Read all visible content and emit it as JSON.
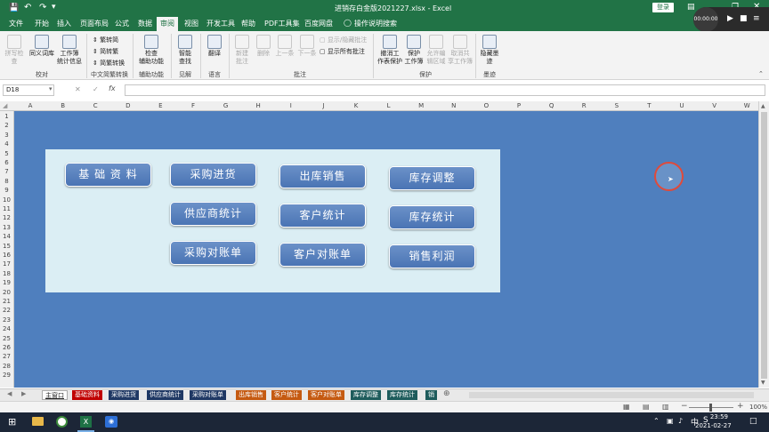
{
  "window": {
    "title": "进销存白金版2021227.xlsx  -  Excel",
    "login_label": "登录",
    "qat_icons": [
      "save-icon",
      "undo-icon",
      "redo-icon",
      "customize-icon"
    ]
  },
  "menu": {
    "items": [
      "文件",
      "开始",
      "插入",
      "页面布局",
      "公式",
      "数据",
      "审阅",
      "视图",
      "开发工具",
      "帮助",
      "PDF工具集",
      "百度网盘"
    ],
    "active": "审阅",
    "tell_me": "操作说明搜索"
  },
  "recorder": {
    "time": "00:00:00"
  },
  "ribbon": {
    "proofing": {
      "spell": "拼写检查",
      "thesaurus": "同义词库",
      "stats": "工作簿\n统计信息",
      "label": "校对"
    },
    "chinese": {
      "to_simplified": "繁转简",
      "to_traditional": "简转繁",
      "convert": "简繁转换",
      "label": "中文简繁转换"
    },
    "access": {
      "check": "检查\n辅助功能",
      "label": "辅助功能"
    },
    "insights": {
      "smart": "智能\n查找",
      "label": "见解"
    },
    "language": {
      "translate": "翻译",
      "label": "语言"
    },
    "comments": {
      "new": "新建\n批注",
      "delete": "删除",
      "prev": "上一条",
      "next": "下一条",
      "show_hide": "显示/隐藏批注",
      "show_all": "显示所有批注",
      "label": "批注"
    },
    "protect": {
      "unprotect": "撤消工\n作表保护",
      "protect_wb": "保护\n工作簿",
      "allow": "允许编\n辑区域",
      "unshare": "取消共\n享工作簿",
      "label": "保护"
    },
    "ink": {
      "hide": "隐藏墨\n迹",
      "label": "墨迹"
    }
  },
  "formula_bar": {
    "name_box": "D18",
    "formula": ""
  },
  "columns": [
    "A",
    "B",
    "C",
    "D",
    "E",
    "F",
    "G",
    "H",
    "I",
    "J",
    "K",
    "L",
    "M",
    "N",
    "O",
    "P",
    "Q",
    "R",
    "S",
    "T",
    "U",
    "V",
    "W"
  ],
  "rows": [
    "1",
    "2",
    "3",
    "4",
    "5",
    "6",
    "7",
    "8",
    "9",
    "10",
    "11",
    "12",
    "13",
    "14",
    "15",
    "16",
    "17",
    "18",
    "19",
    "20",
    "21",
    "22",
    "23",
    "24",
    "25",
    "26",
    "27",
    "28",
    "29"
  ],
  "nav_buttons": [
    "基 础 资 料",
    "采购进货",
    "出库销售",
    "库存调整",
    "供应商统计",
    "客户统计",
    "库存统计",
    "采购对账单",
    "客户对账单",
    "销售利润"
  ],
  "sheet_tabs": [
    {
      "name": "主窗口",
      "color": "#ffffff",
      "text": "#222222"
    },
    {
      "name": "基础资料",
      "color": "#c00000",
      "text": "#ffffff"
    },
    {
      "name": "采购进货",
      "color": "#1f3864",
      "text": "#ffffff"
    },
    {
      "name": "供应商统计",
      "color": "#1f3864",
      "text": "#ffffff"
    },
    {
      "name": "采购对账单",
      "color": "#1f3864",
      "text": "#ffffff"
    },
    {
      "name": "出库销售",
      "color": "#c55a11",
      "text": "#ffffff"
    },
    {
      "name": "客户统计",
      "color": "#c55a11",
      "text": "#ffffff"
    },
    {
      "name": "客户对账单",
      "color": "#c55a11",
      "text": "#ffffff"
    },
    {
      "name": "库存调整",
      "color": "#1e5c5c",
      "text": "#ffffff"
    },
    {
      "name": "库存统计",
      "color": "#1e5c5c",
      "text": "#ffffff"
    },
    {
      "name": "销",
      "color": "#1e5c5c",
      "text": "#ffffff"
    }
  ],
  "status": {
    "zoom": "100%"
  },
  "taskbar": {
    "ime": "中",
    "time": "23:59",
    "date": "2021-02-27"
  }
}
